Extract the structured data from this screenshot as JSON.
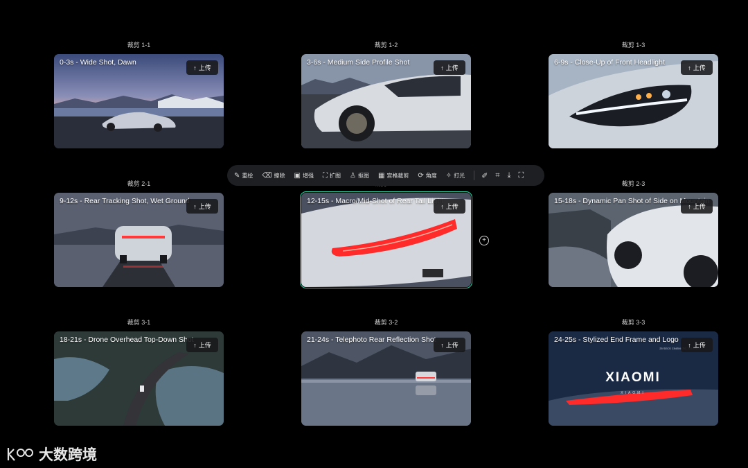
{
  "toolbar": {
    "tools": [
      {
        "label": "重绘",
        "icon": "repaint-icon"
      },
      {
        "label": "擦除",
        "icon": "eraser-icon"
      },
      {
        "label": "增强",
        "icon": "hd-enhance-icon"
      },
      {
        "label": "扩图",
        "icon": "expand-icon"
      },
      {
        "label": "抠图",
        "icon": "cutout-icon"
      },
      {
        "label": "宫格裁剪",
        "icon": "grid-crop-icon"
      },
      {
        "label": "角度",
        "icon": "angle-icon"
      },
      {
        "label": "打光",
        "icon": "lighting-icon"
      }
    ],
    "extra_icons": [
      "brush-icon",
      "crop-icon",
      "download-icon",
      "fullscreen-icon"
    ]
  },
  "upload_label": "上传",
  "cells": [
    {
      "label": "裁剪 1-1",
      "title": "0-3s - Wide Shot, Dawn"
    },
    {
      "label": "裁剪 1-2",
      "title": "3-6s - Medium Side Profile Shot"
    },
    {
      "label": "裁剪 1-3",
      "title": "6-9s - Close-Up of Front Headlight"
    },
    {
      "label": "裁剪 2-1",
      "title": "9-12s - Rear Tracking Shot, Wet Ground"
    },
    {
      "label": "裁剪 2-2",
      "title": "12-15s - Macro/Mid-Shot of Rear Tail Light"
    },
    {
      "label": "裁剪 2-3",
      "title": "15-18s - Dynamic Pan Shot of Side on Mountain"
    },
    {
      "label": "裁剪 3-1",
      "title": "18-21s - Drone Overhead Top-Down Shot"
    },
    {
      "label": "裁剪 3-2",
      "title": "21-24s - Telephoto Rear Reflection Shot"
    },
    {
      "label": "裁剪 3-3",
      "title": "24-25s - Stylized End Frame and Logo"
    }
  ],
  "end_frame": {
    "brand": "XIAOMI",
    "sub": "XIAOMI",
    "tagline": "25 SECS CINEMATIC JOURNEY"
  },
  "watermark": {
    "text": "大数跨境"
  },
  "colors": {
    "background": "#000000",
    "selected_outline": "#2fd3a4",
    "toolbar_bg": "#1e1f22",
    "tail_light": "#ff2a2a"
  }
}
